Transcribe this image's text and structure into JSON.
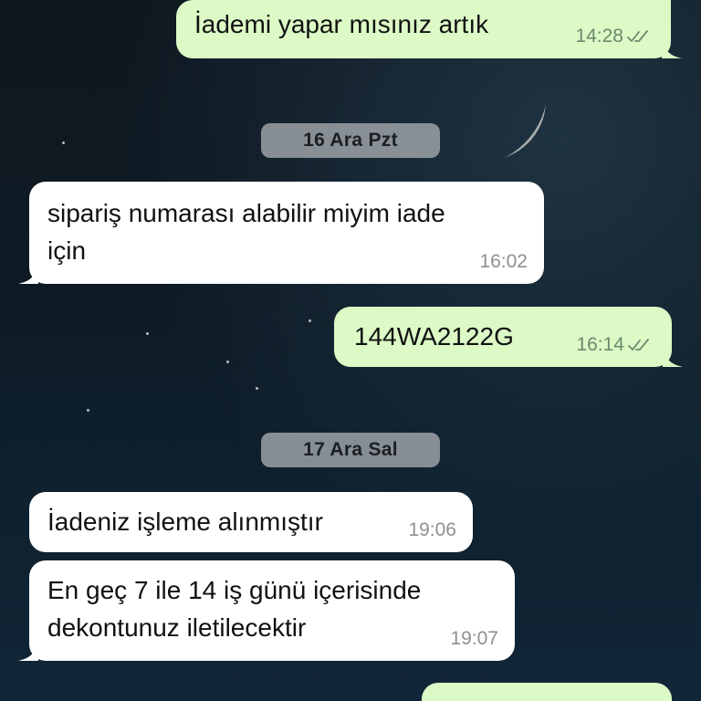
{
  "dates": {
    "day1": "16 Ara Pzt",
    "day2": "17 Ara Sal"
  },
  "messages": [
    {
      "direction": "outgoing",
      "text": "İademi yapar mısınız artık",
      "time": "14:28",
      "status": "read"
    },
    {
      "direction": "incoming",
      "text_line1": "sipariş numarası alabilir miyim iade",
      "text_line2": "için",
      "time": "16:02"
    },
    {
      "direction": "outgoing",
      "text": "144WA2122G",
      "time": "16:14",
      "status": "read"
    },
    {
      "direction": "incoming",
      "text": "İadeniz işleme alınmıştır",
      "time": "19:06"
    },
    {
      "direction": "incoming",
      "text_line1": "En geç 7 ile 14 iş günü içerisinde",
      "text_line2": "dekontunuz iletilecektir",
      "time": "19:07"
    }
  ],
  "colors": {
    "outgoing_bubble": "#dcf9c6",
    "incoming_bubble": "#ffffff",
    "date_chip": "#a8adb2"
  },
  "icons": {
    "read_receipt": "double-check-icon",
    "background": "crescent-moon-night-sky"
  }
}
